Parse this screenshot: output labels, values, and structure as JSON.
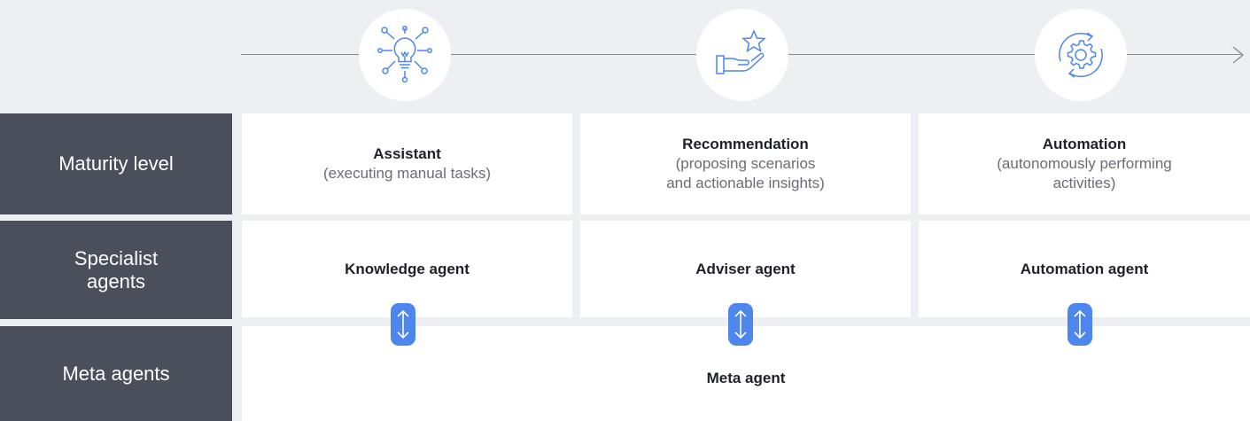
{
  "timeline": {
    "stages": [
      {
        "icon": "lightbulb-network-icon"
      },
      {
        "icon": "hand-star-icon"
      },
      {
        "icon": "gear-cycle-icon"
      }
    ],
    "accent_color": "#4d86ec"
  },
  "rows": {
    "maturity": {
      "header": "Maturity level",
      "cells": [
        {
          "title": "Assistant",
          "desc": "(executing manual tasks)"
        },
        {
          "title": "Recommendation",
          "desc": "(proposing scenarios\nand actionable insights)"
        },
        {
          "title": "Automation",
          "desc": "(autonomously performing\nactivities)"
        }
      ]
    },
    "specialist": {
      "header": "Specialist\nagents",
      "cells": [
        "Knowledge agent",
        "Adviser agent",
        "Automation agent"
      ]
    },
    "meta": {
      "header": "Meta agents",
      "cell": "Meta agent"
    }
  },
  "connectors": [
    {
      "icon": "bidirectional-arrow-icon"
    },
    {
      "icon": "bidirectional-arrow-icon"
    },
    {
      "icon": "bidirectional-arrow-icon"
    }
  ],
  "colors": {
    "background": "#eeeff3",
    "header_bg": "#4b4f5c",
    "cell_bg": "#ffffff",
    "line": "#8a8c95",
    "icon_stroke": "#4d86ec"
  }
}
